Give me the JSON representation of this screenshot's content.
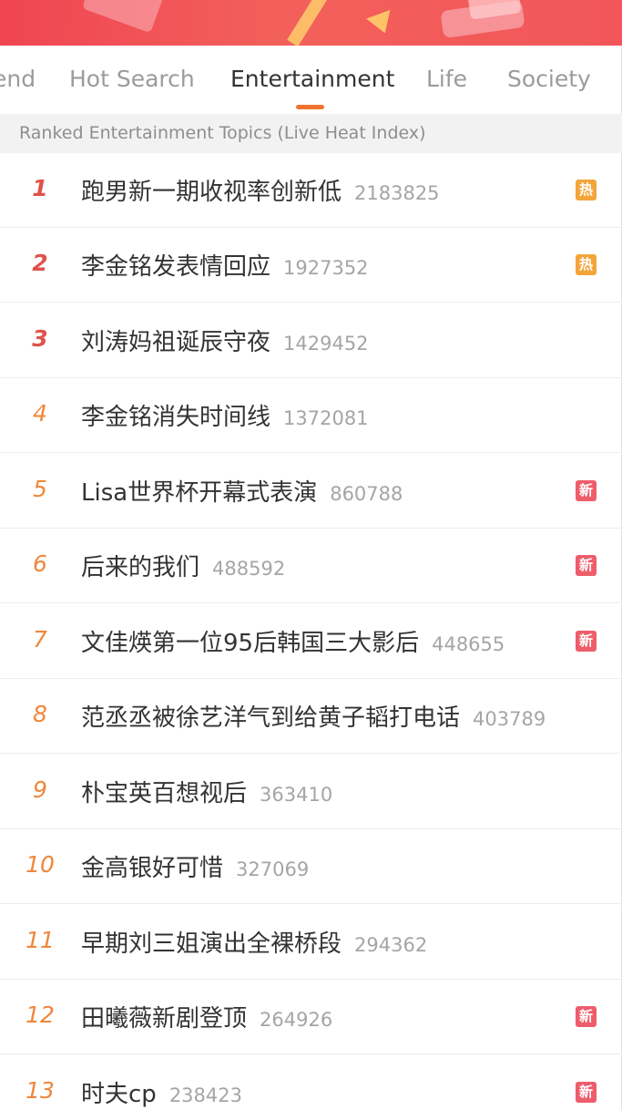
{
  "tabs": [
    {
      "label": "end"
    },
    {
      "label": "Hot Search"
    },
    {
      "label": "Entertainment"
    },
    {
      "label": "Life"
    },
    {
      "label": "Society"
    }
  ],
  "subheader": "Ranked Entertainment Topics (Live Heat Index)",
  "rows": [
    {
      "rank": "1",
      "title": "跑男新一期收视率创新低",
      "heat": "2183825",
      "badge": "热"
    },
    {
      "rank": "2",
      "title": "李金铭发表情回应",
      "heat": "1927352",
      "badge": "热"
    },
    {
      "rank": "3",
      "title": "刘涛妈祖诞辰守夜",
      "heat": "1429452",
      "badge": ""
    },
    {
      "rank": "4",
      "title": "李金铭消失时间线",
      "heat": "1372081",
      "badge": ""
    },
    {
      "rank": "5",
      "title": "Lisa世界杯开幕式表演",
      "heat": "860788",
      "badge": "新"
    },
    {
      "rank": "6",
      "title": "后来的我们",
      "heat": "488592",
      "badge": "新"
    },
    {
      "rank": "7",
      "title": "文佳煐第一位95后韩国三大影后",
      "heat": "448655",
      "badge": "新"
    },
    {
      "rank": "8",
      "title": "范丞丞被徐艺洋气到给黄子韬打电话",
      "heat": "403789",
      "badge": ""
    },
    {
      "rank": "9",
      "title": "朴宝英百想视后",
      "heat": "363410",
      "badge": ""
    },
    {
      "rank": "10",
      "title": "金高银好可惜",
      "heat": "327069",
      "badge": ""
    },
    {
      "rank": "11",
      "title": "早期刘三姐演出全裸桥段",
      "heat": "294362",
      "badge": ""
    },
    {
      "rank": "12",
      "title": "田曦薇新剧登顶",
      "heat": "264926",
      "badge": "新"
    },
    {
      "rank": "13",
      "title": "时夫cp",
      "heat": "238423",
      "badge": "新"
    }
  ]
}
